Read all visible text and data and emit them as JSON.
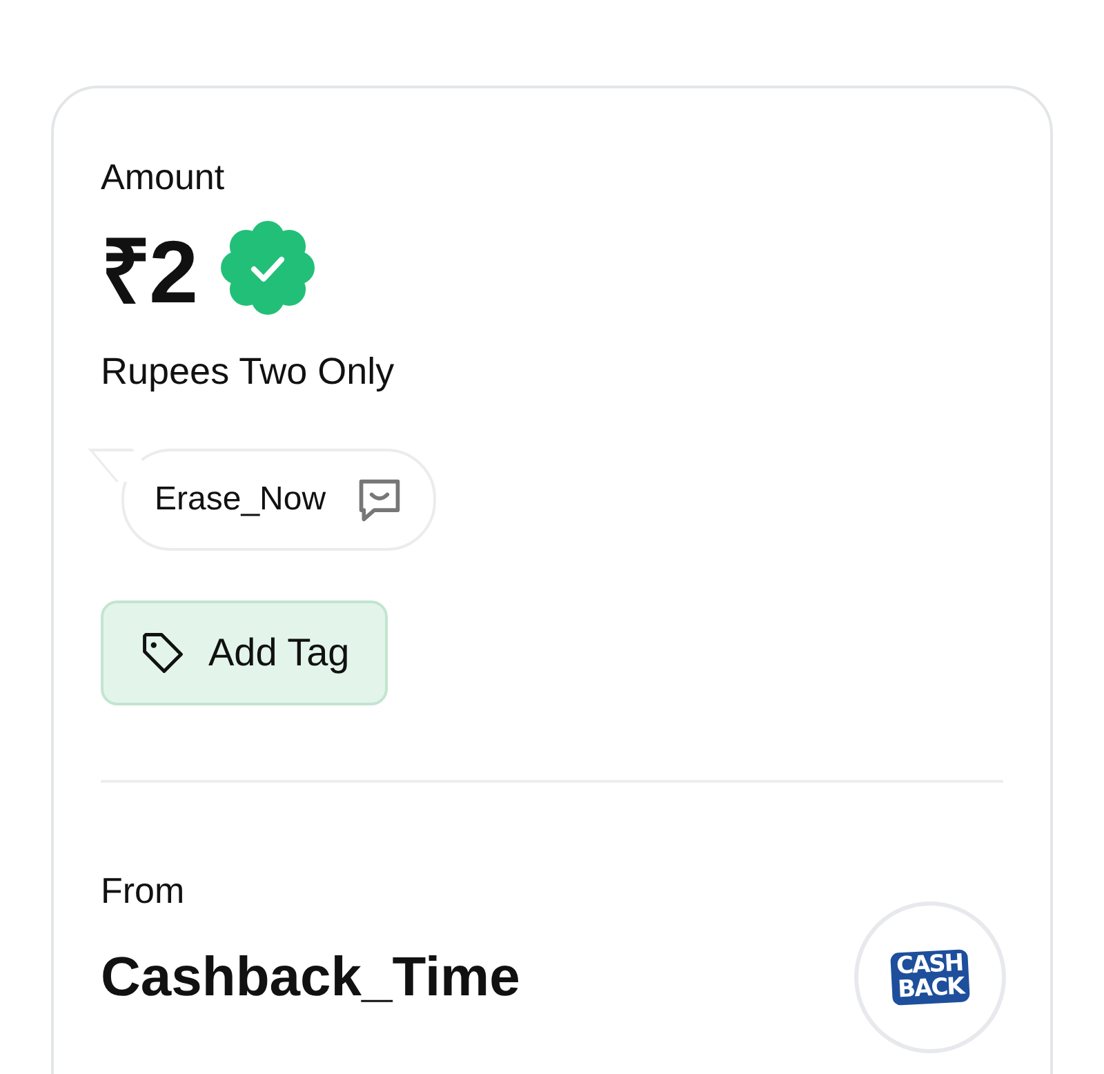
{
  "amount": {
    "label": "Amount",
    "value": "₹2",
    "verified": true,
    "in_words": "Rupees Two Only"
  },
  "note": {
    "text": "Erase_Now"
  },
  "add_tag": {
    "label": "Add Tag"
  },
  "from": {
    "label": "From",
    "name": "Cashback_Time",
    "logo_lines": [
      "CASH",
      "BACK"
    ]
  }
}
